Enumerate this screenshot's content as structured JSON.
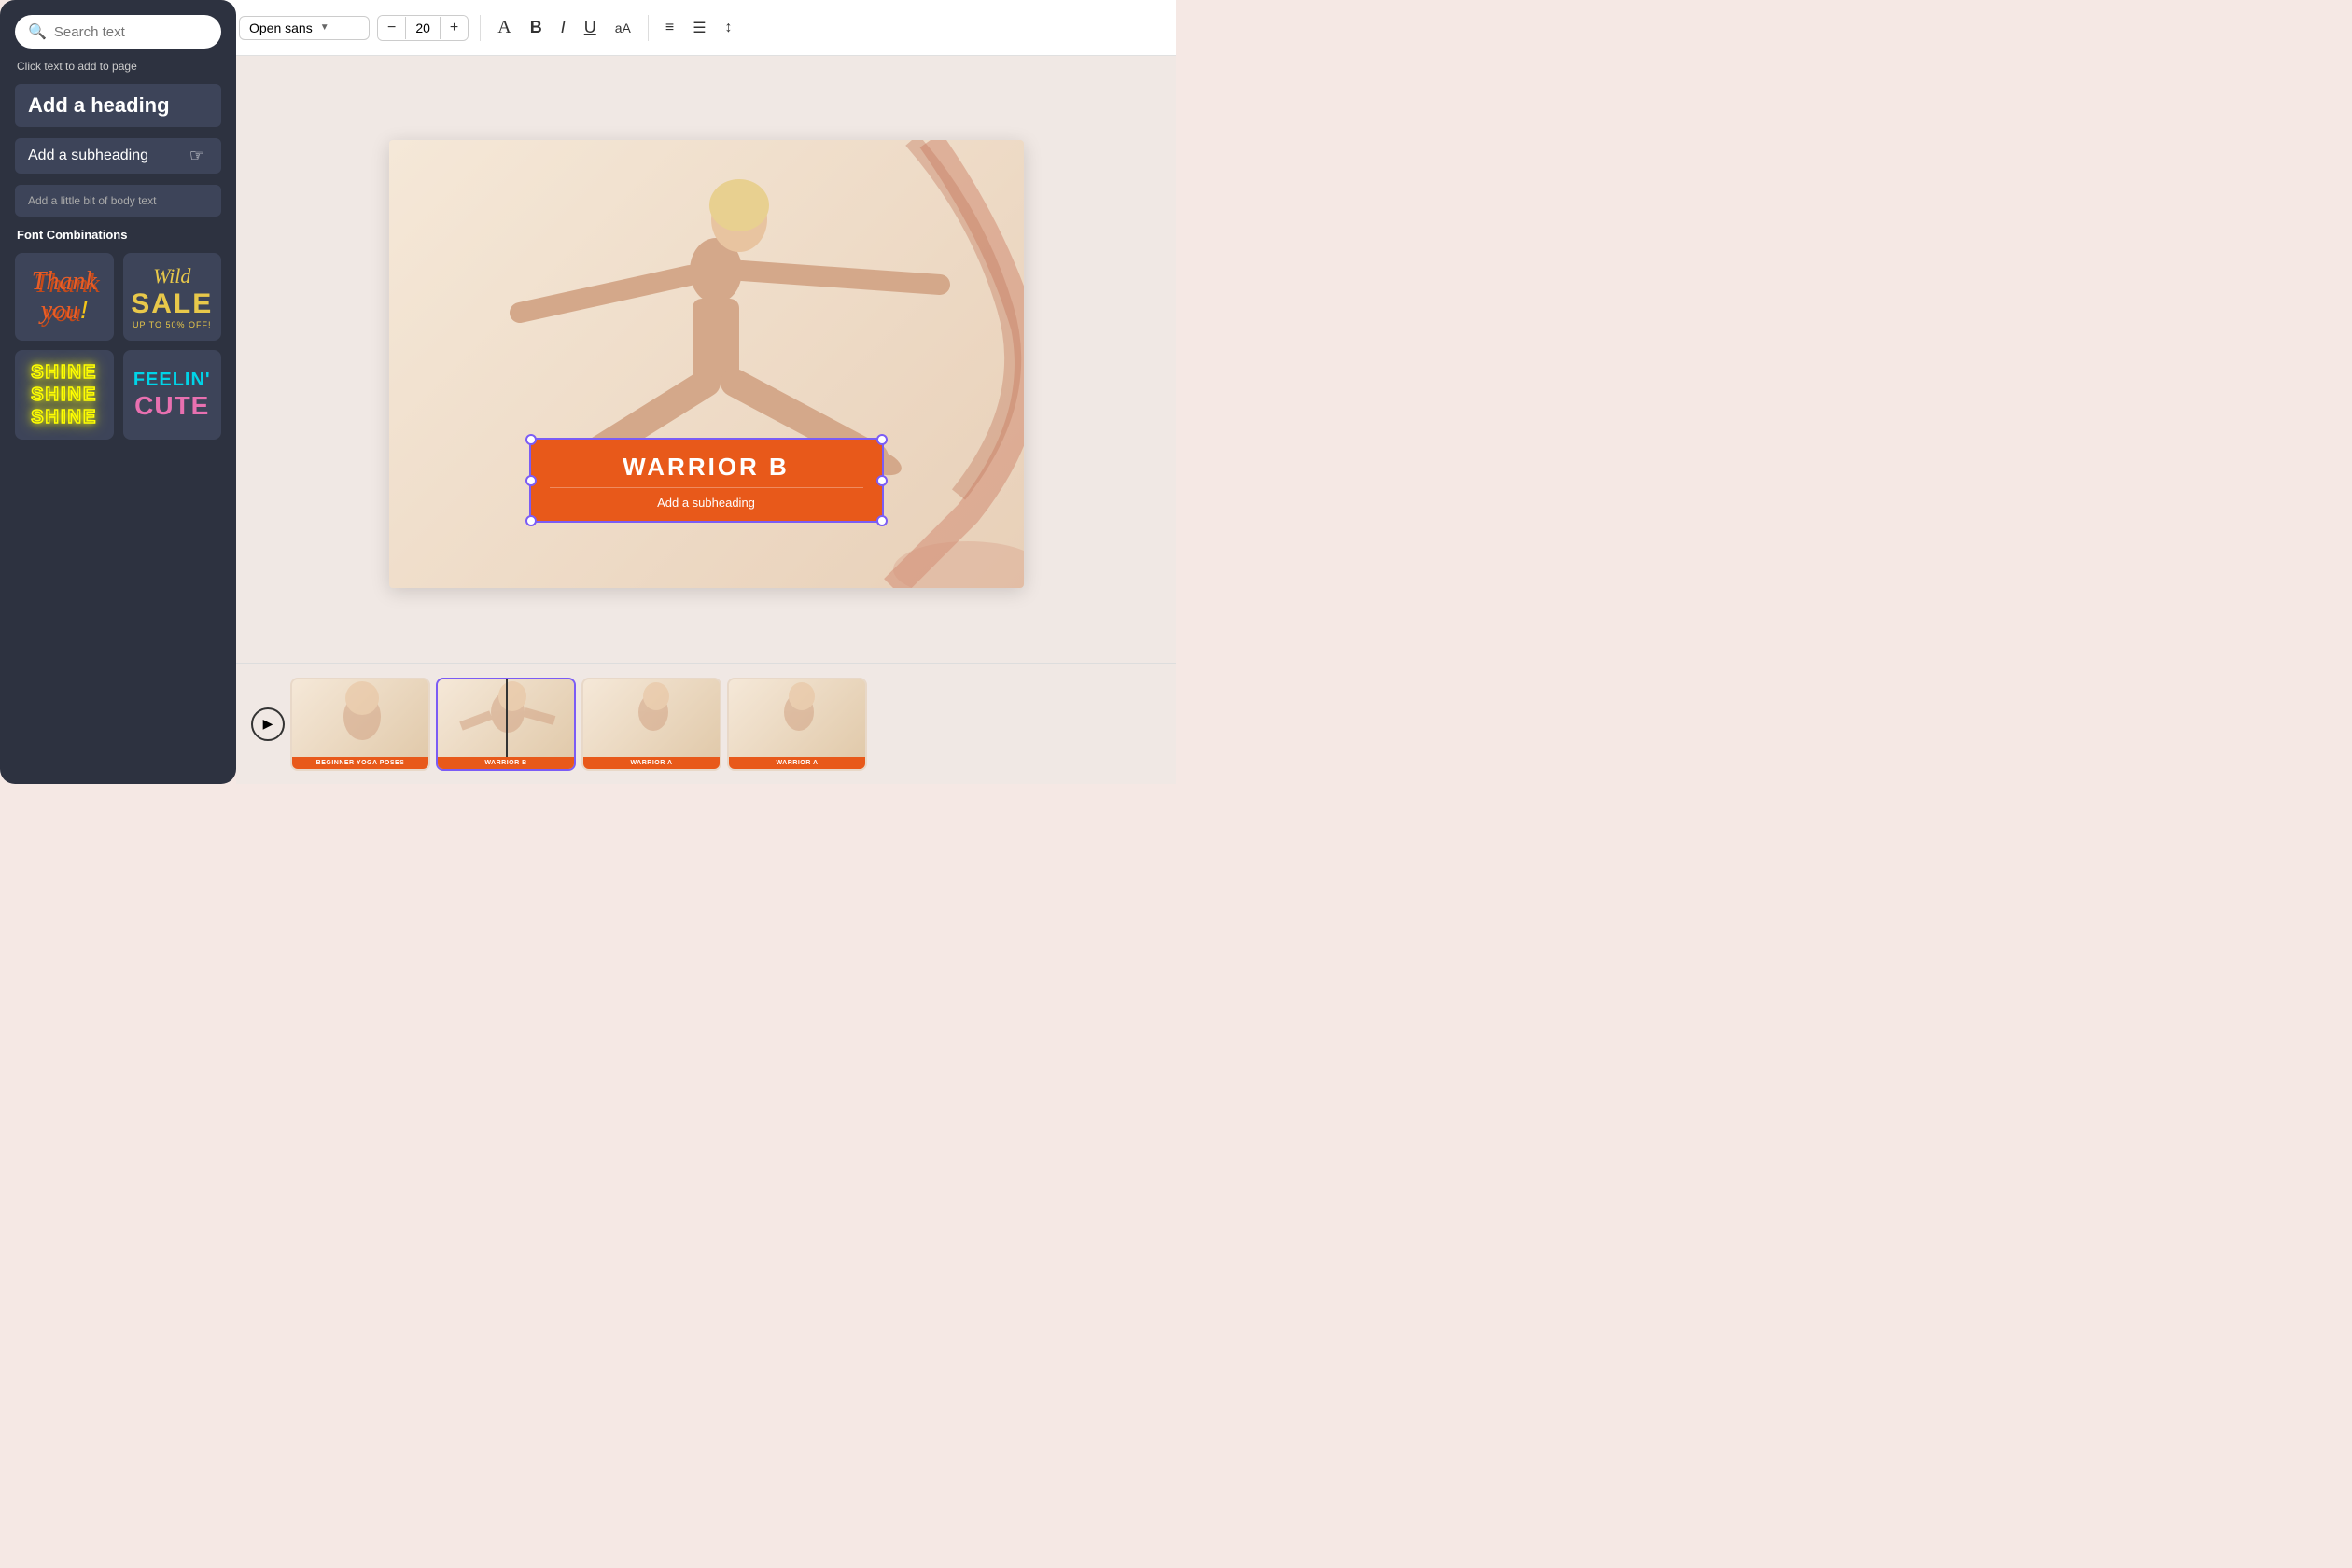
{
  "toolbar": {
    "font_name": "Open sans",
    "font_size": "20",
    "minus_label": "−",
    "plus_label": "+",
    "text_a_label": "A",
    "bold_label": "B",
    "italic_label": "I",
    "underline_label": "U",
    "case_label": "aA",
    "align_label": "≡",
    "list_label": "≡",
    "line_label": "≡"
  },
  "sidebar": {
    "search_placeholder": "Search text",
    "click_hint": "Click text to add to page",
    "heading_label": "Add a heading",
    "subheading_label": "Add a subheading",
    "body_label": "Add a little bit of body text",
    "font_combos_label": "Font Combinations",
    "combos": [
      {
        "id": "thankyou",
        "label": "Thank you!"
      },
      {
        "id": "wildsale",
        "label": "Wild SALE UP TO 50% OFF!"
      },
      {
        "id": "shine",
        "label": "SHINE SHINE SHINE"
      },
      {
        "id": "feelin",
        "label": "FEELIN' CUTE"
      }
    ]
  },
  "canvas": {
    "banner_title": "WARRIOR B",
    "banner_subheading": "Add a subheading"
  },
  "timeline": {
    "play_label": "▶",
    "slides": [
      {
        "label": "BEGINNER YOGA POSES",
        "active": false
      },
      {
        "label": "WARRIOR B",
        "active": true
      },
      {
        "label": "WARRIOR A",
        "active": false
      },
      {
        "label": "WARRIOR A",
        "active": false
      }
    ]
  }
}
